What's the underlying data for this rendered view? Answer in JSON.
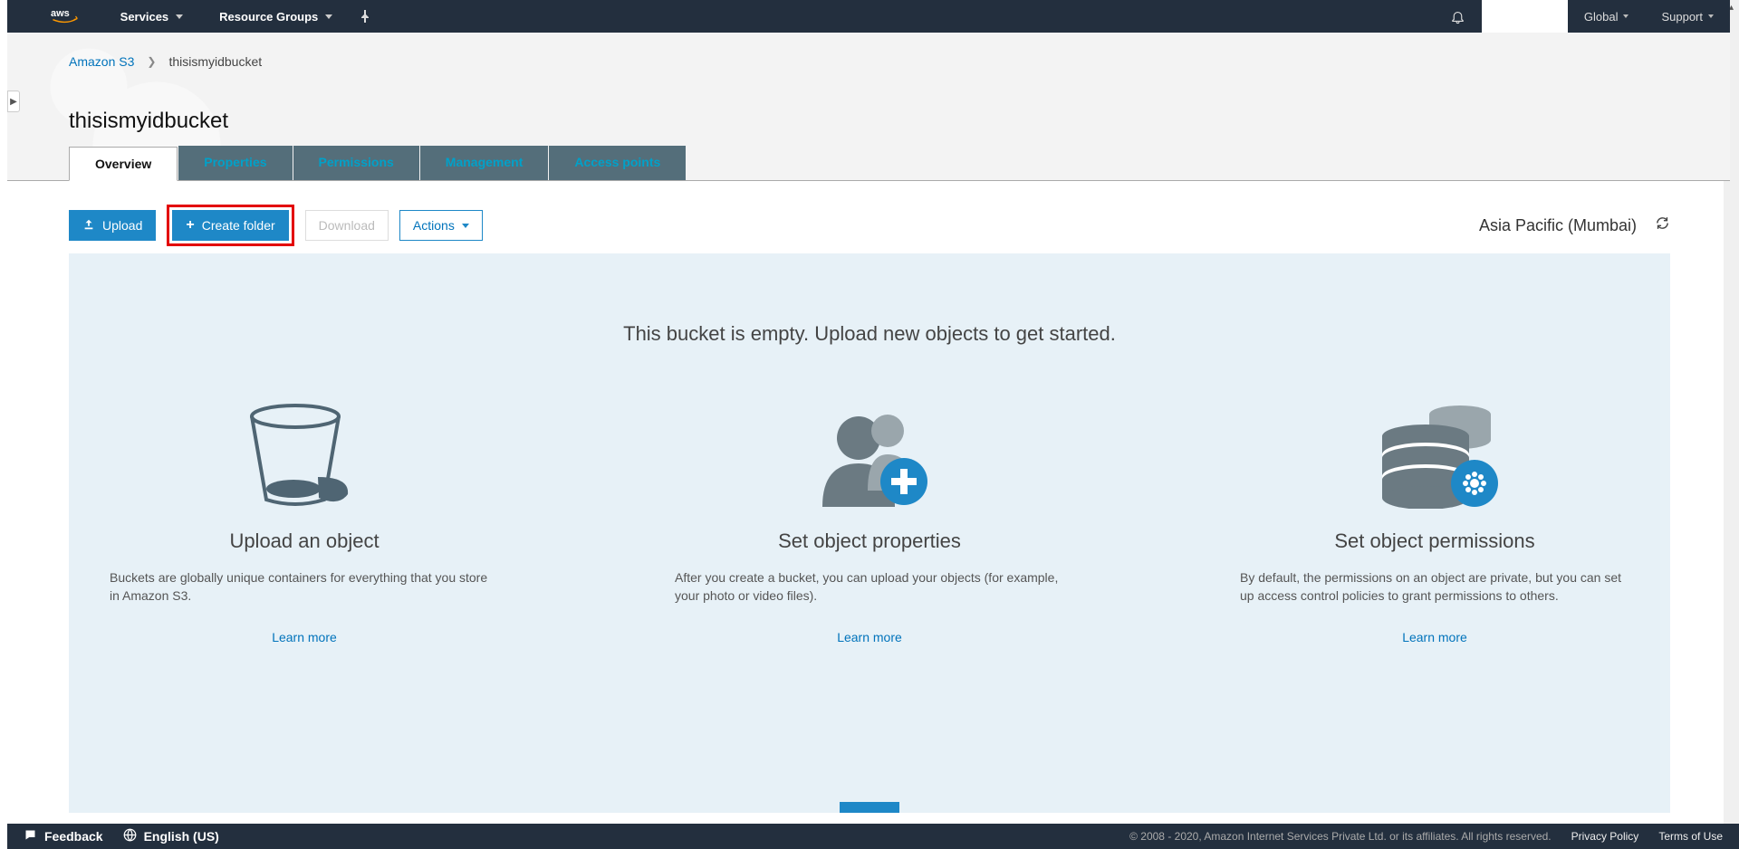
{
  "nav": {
    "services": "Services",
    "resource_groups": "Resource Groups",
    "global": "Global",
    "support": "Support"
  },
  "breadcrumb": {
    "root": "Amazon S3",
    "current": "thisismyidbucket"
  },
  "title": "thisismyidbucket",
  "tabs": {
    "overview": "Overview",
    "properties": "Properties",
    "permissions": "Permissions",
    "management": "Management",
    "access_points": "Access points"
  },
  "toolbar": {
    "upload": "Upload",
    "create_folder": "Create folder",
    "download": "Download",
    "actions": "Actions",
    "region": "Asia Pacific (Mumbai)"
  },
  "empty": {
    "title": "This bucket is empty. Upload new objects to get started.",
    "cards": [
      {
        "heading": "Upload an object",
        "body": "Buckets are globally unique containers for everything that you store in Amazon S3.",
        "link": "Learn more"
      },
      {
        "heading": "Set object properties",
        "body": "After you create a bucket, you can upload your objects (for example, your photo or video files).",
        "link": "Learn more"
      },
      {
        "heading": "Set object permissions",
        "body": "By default, the permissions on an object are private, but you can set up access control policies to grant permissions to others.",
        "link": "Learn more"
      }
    ]
  },
  "footer": {
    "feedback": "Feedback",
    "language": "English (US)",
    "copyright": "© 2008 - 2020, Amazon Internet Services Private Ltd. or its affiliates. All rights reserved.",
    "privacy": "Privacy Policy",
    "terms": "Terms of Use"
  }
}
